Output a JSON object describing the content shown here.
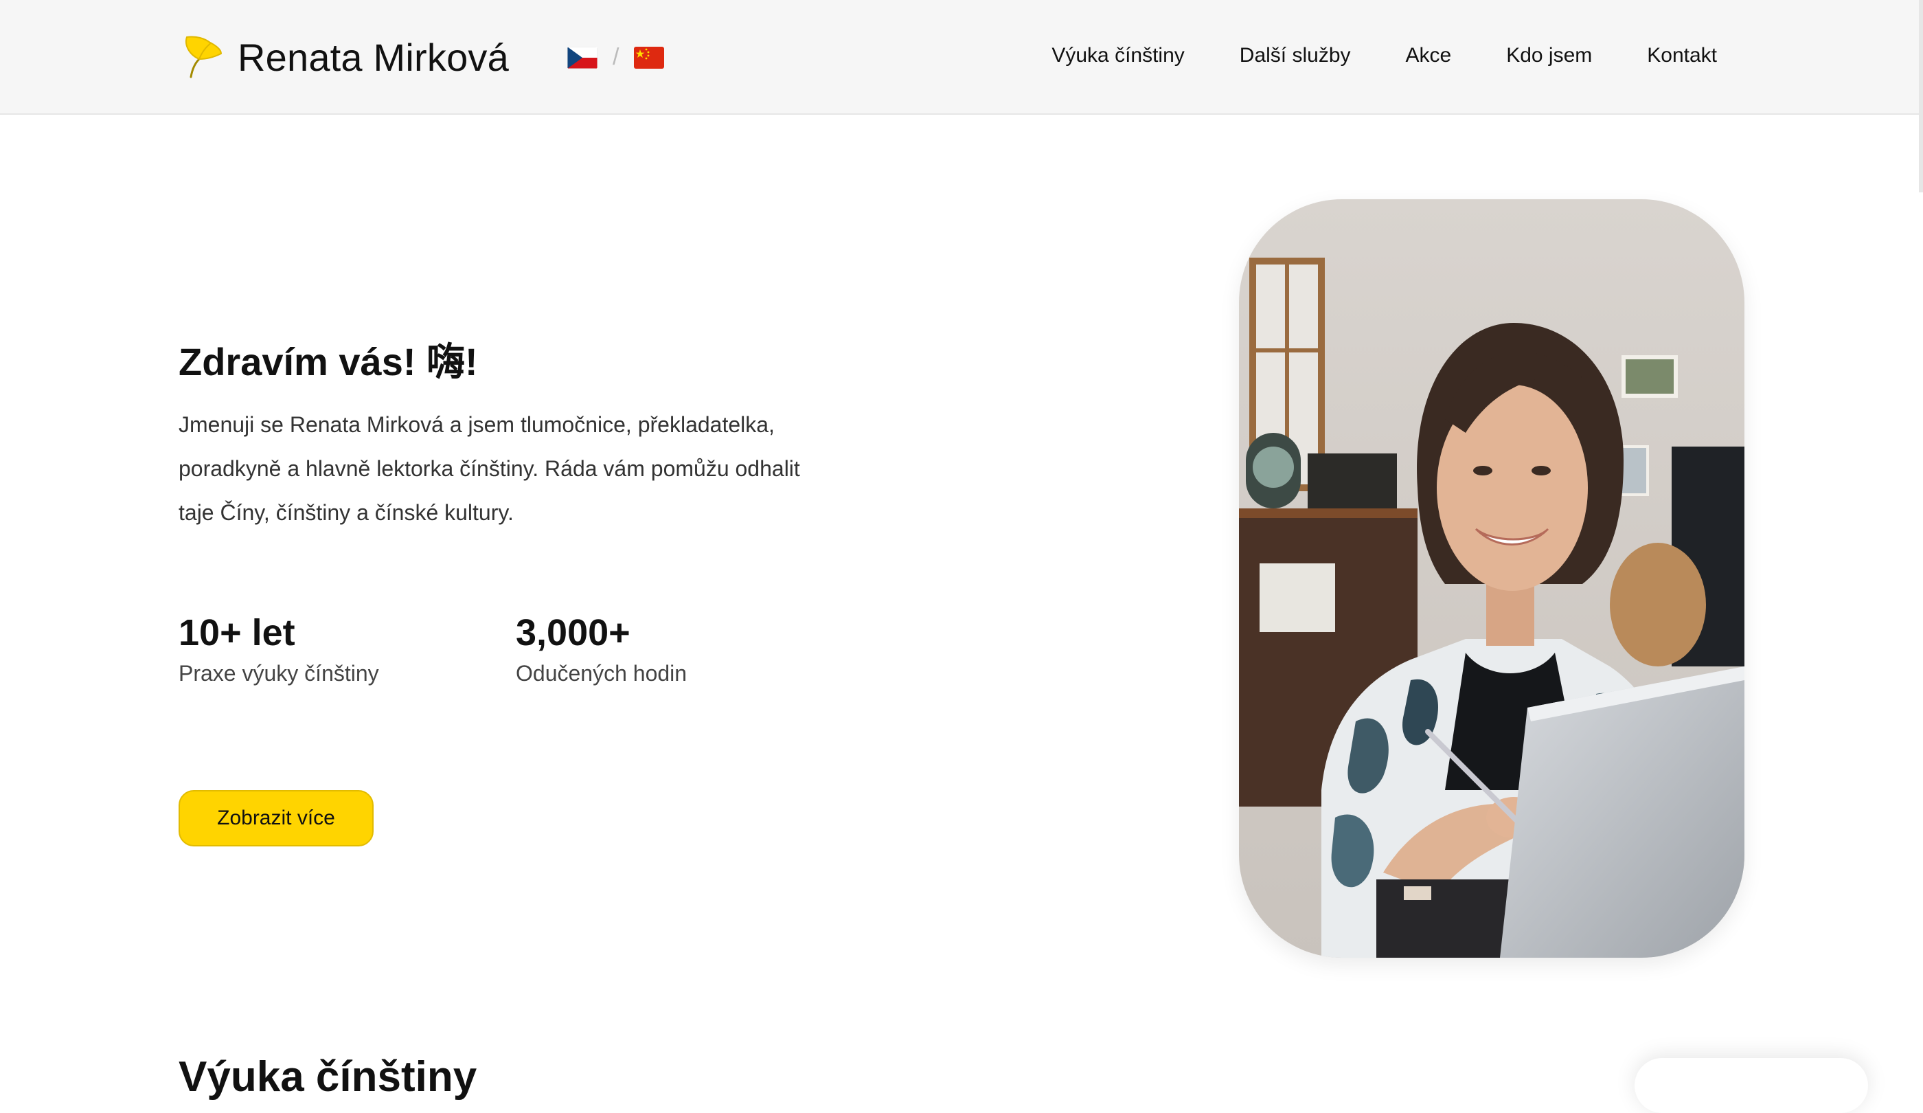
{
  "header": {
    "brand_name": "Renata Mirková",
    "logo_icon": "ginkgo-leaf-icon",
    "brand_color": "#ffd400",
    "languages": [
      {
        "code": "cz",
        "icon": "czech-flag-icon"
      },
      {
        "code": "cn",
        "icon": "chinese-flag-icon"
      }
    ],
    "language_separator": "/",
    "nav": [
      {
        "label": "Výuka čínštiny"
      },
      {
        "label": "Další služby"
      },
      {
        "label": "Akce"
      },
      {
        "label": "Kdo jsem"
      },
      {
        "label": "Kontakt"
      }
    ]
  },
  "hero": {
    "greeting": "Zdravím vás! 嗨!",
    "intro": "Jmenuji se Renata Mirková a jsem tlumočnice, překladatelka, poradkyně a hlavně lektorka čínštiny. Ráda vám pomůžu odhalit taje Číny, čínštiny a čínské kultury.",
    "stats": [
      {
        "value": "10+ let",
        "label": "Praxe výuky čínštiny"
      },
      {
        "value": "3,000+",
        "label": "Odučených hodin"
      }
    ],
    "cta_label": "Zobrazit více",
    "cta_color": "#ffd400",
    "photo": "portrait-photo"
  },
  "next_section": {
    "title": "Výuka čínštiny"
  }
}
